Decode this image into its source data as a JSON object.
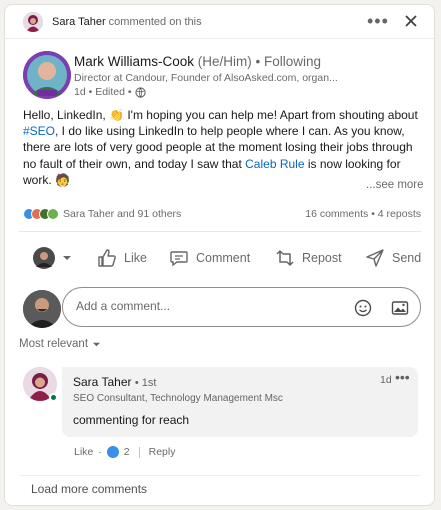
{
  "header": {
    "actor_name": "Sara Taher",
    "actor_action": "commented on this",
    "more_icon": "more-horizontal-icon",
    "close_icon": "close-icon"
  },
  "post": {
    "author_name": "Mark Williams-Cook",
    "author_pronouns": "(He/Him)",
    "follow_status": "• Following",
    "author_headline": "Director at Candour, Founder of AlsoAsked.com, organ...",
    "meta": "1d • Edited •",
    "body_part1": "Hello, LinkedIn, 👏 I'm hoping you can help me! Apart from shouting about ",
    "hashtag": "#SEO",
    "body_part2": ", I do like using LinkedIn to help people where I can. As you know, there are lots of very good people at the moment losing their jobs through no fault of their own, and today I saw that ",
    "mention": "Caleb Rule",
    "body_part3": " is now looking for work. 🧑",
    "see_more": "...see more"
  },
  "social": {
    "reactions_text": "Sara Taher and 91 others",
    "comments_count": "16 comments",
    "reposts_count": "• 4 reposts",
    "reaction_colors": [
      "#378fe9",
      "#df704d",
      "#44712e"
    ]
  },
  "actions": {
    "like": "Like",
    "comment": "Comment",
    "repost": "Repost",
    "send": "Send"
  },
  "comment_box": {
    "placeholder": "Add a comment..."
  },
  "sort": {
    "label": "Most relevant"
  },
  "comment": {
    "name": "Sara Taher",
    "degree": "• 1st",
    "headline": "SEO Consultant, Technology Management Msc",
    "time": "1d",
    "text": "commenting for reach",
    "like_label": "Like",
    "dot": "·",
    "like_count": "2",
    "reply_label": "Reply"
  },
  "footer": {
    "load_more": "Load more comments"
  },
  "colors": {
    "link": "#0a66c2",
    "online": "#057642",
    "avatar_ring": "#7b3fb0"
  }
}
